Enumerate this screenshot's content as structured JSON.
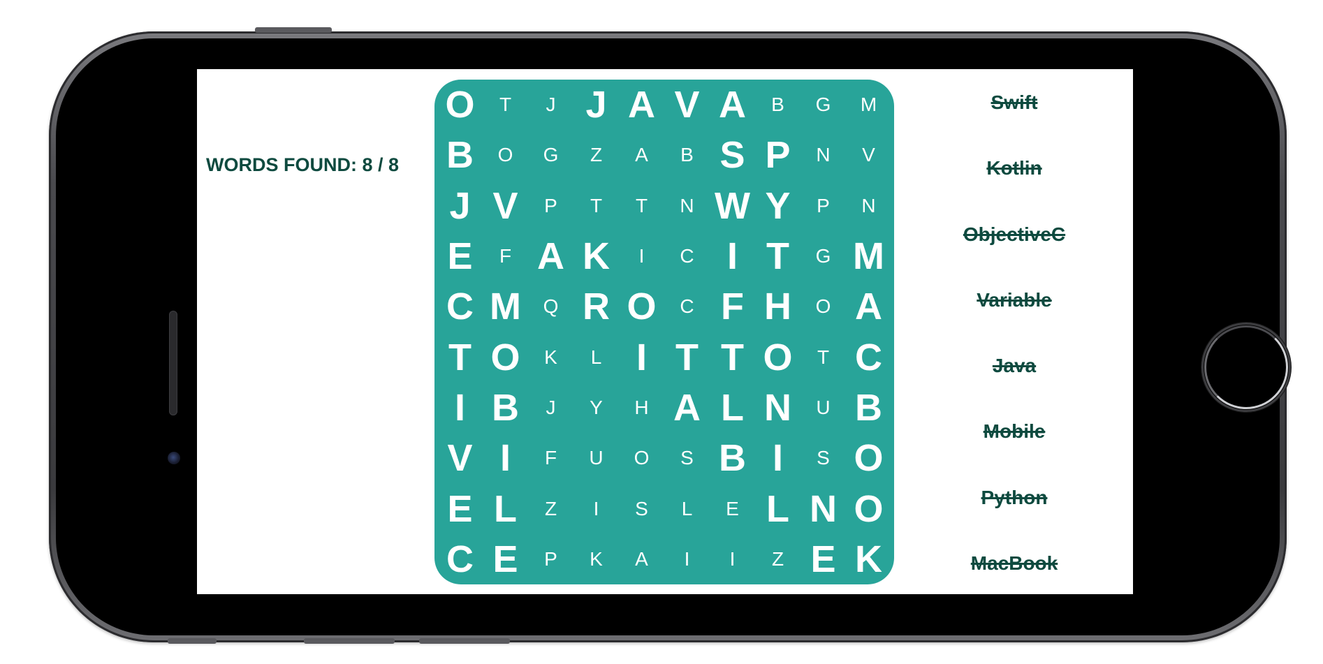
{
  "status": {
    "words_found": "WORDS FOUND: 8 / 8"
  },
  "grid": {
    "rows": [
      [
        "O",
        "T",
        "J",
        "J",
        "A",
        "V",
        "A",
        "B",
        "G",
        "M"
      ],
      [
        "B",
        "O",
        "G",
        "Z",
        "A",
        "B",
        "S",
        "P",
        "N",
        "V"
      ],
      [
        "J",
        "V",
        "P",
        "T",
        "T",
        "N",
        "W",
        "Y",
        "P",
        "N"
      ],
      [
        "E",
        "F",
        "A",
        "K",
        "I",
        "C",
        "I",
        "T",
        "G",
        "M"
      ],
      [
        "C",
        "M",
        "Q",
        "R",
        "O",
        "C",
        "F",
        "H",
        "O",
        "A"
      ],
      [
        "T",
        "O",
        "K",
        "L",
        "I",
        "T",
        "T",
        "O",
        "T",
        "C"
      ],
      [
        "I",
        "B",
        "J",
        "Y",
        "H",
        "A",
        "L",
        "N",
        "U",
        "B"
      ],
      [
        "V",
        "I",
        "F",
        "U",
        "O",
        "S",
        "B",
        "I",
        "S",
        "O"
      ],
      [
        "E",
        "L",
        "Z",
        "I",
        "S",
        "L",
        "E",
        "L",
        "N",
        "O"
      ],
      [
        "C",
        "E",
        "P",
        "K",
        "A",
        "I",
        "I",
        "Z",
        "E",
        "K"
      ]
    ],
    "highlighted": [
      [
        1,
        0,
        0,
        1,
        1,
        1,
        1,
        0,
        0,
        0
      ],
      [
        1,
        0,
        0,
        0,
        0,
        0,
        1,
        1,
        0,
        0
      ],
      [
        1,
        1,
        0,
        0,
        0,
        0,
        1,
        1,
        0,
        0
      ],
      [
        1,
        0,
        1,
        1,
        0,
        0,
        1,
        1,
        0,
        1
      ],
      [
        1,
        1,
        0,
        1,
        1,
        0,
        1,
        1,
        0,
        1
      ],
      [
        1,
        1,
        0,
        0,
        1,
        1,
        1,
        1,
        0,
        1
      ],
      [
        1,
        1,
        0,
        0,
        0,
        1,
        1,
        1,
        0,
        1
      ],
      [
        1,
        1,
        0,
        0,
        0,
        0,
        1,
        1,
        0,
        1
      ],
      [
        1,
        1,
        0,
        0,
        0,
        0,
        0,
        1,
        1,
        1
      ],
      [
        1,
        1,
        0,
        0,
        0,
        0,
        0,
        0,
        1,
        1
      ]
    ],
    "colors": {
      "board": "#28a499",
      "letter": "#ffffff"
    }
  },
  "word_list": {
    "items": [
      "Swift",
      "Kotlin",
      "ObjectiveC",
      "Variable",
      "Java",
      "Mobile",
      "Python",
      "MacBook"
    ]
  },
  "theme": {
    "text_dark_green": "#0e4a3f"
  }
}
